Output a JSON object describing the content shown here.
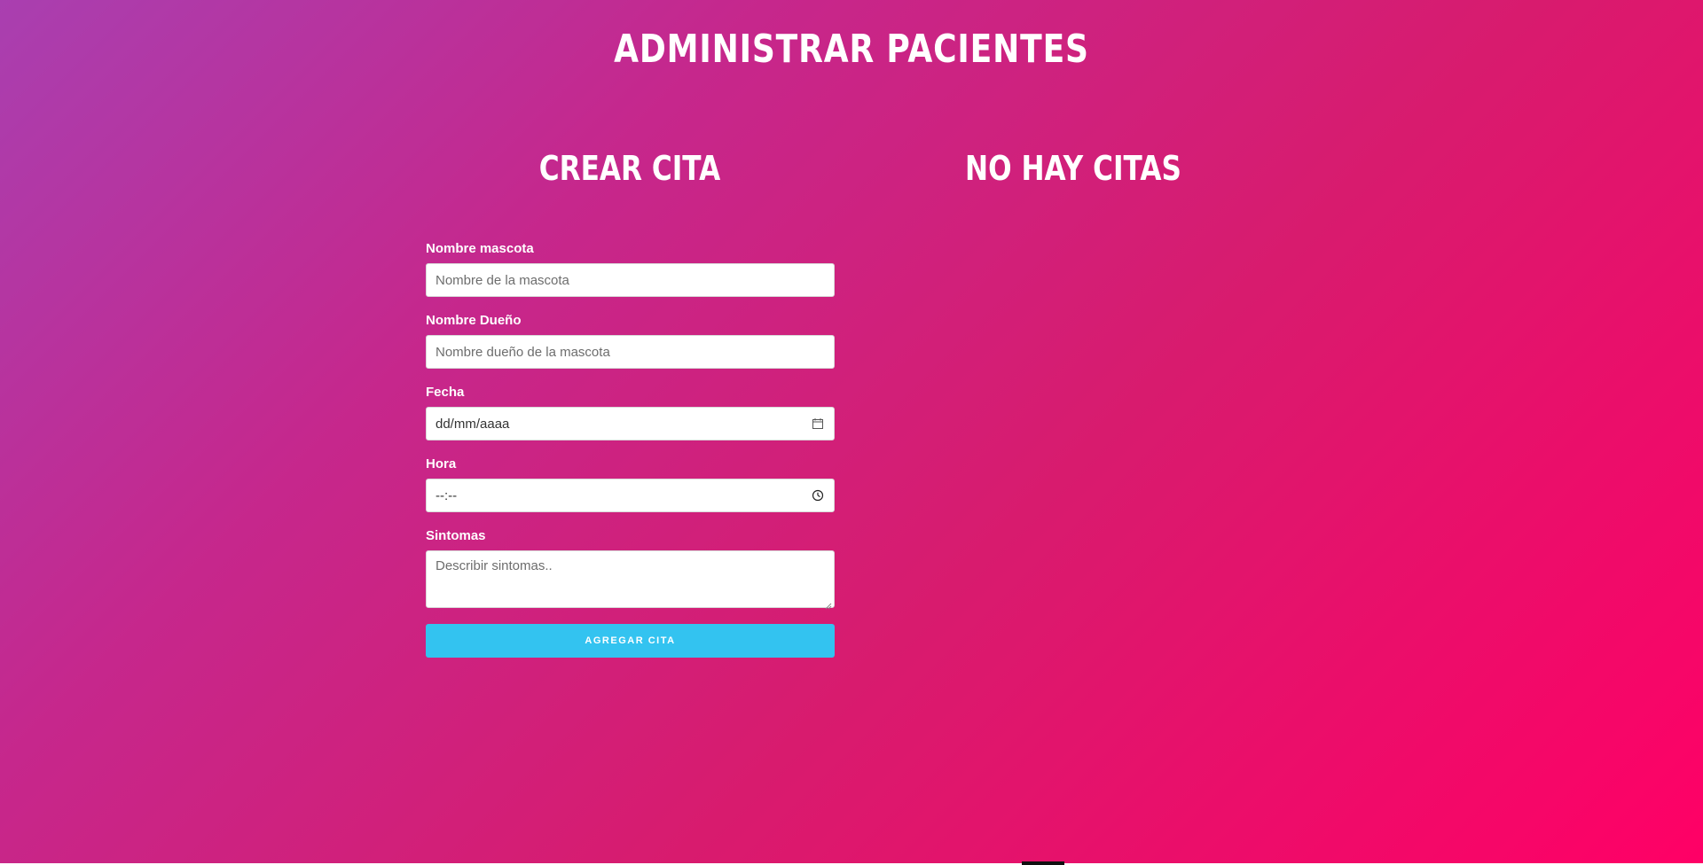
{
  "header": {
    "title": "ADMINISTRAR PACIENTES"
  },
  "left_column": {
    "title": "CREAR CITA"
  },
  "right_column": {
    "title": "NO HAY CITAS"
  },
  "form": {
    "pet_name": {
      "label": "Nombre mascota",
      "placeholder": "Nombre de la mascota"
    },
    "owner_name": {
      "label": "Nombre Dueño",
      "placeholder": "Nombre dueño de la mascota"
    },
    "date": {
      "label": "Fecha",
      "value": "dd/mm/aaaa",
      "icon": "calendar-icon"
    },
    "time": {
      "label": "Hora",
      "value": "--:--",
      "icon": "clock-icon"
    },
    "symptoms": {
      "label": "Sintomas",
      "placeholder": "Describir sintomas.."
    },
    "submit_label": "AGREGAR CITA"
  },
  "colors": {
    "gradient_start": "#a93fb0",
    "gradient_end": "#ff0066",
    "button": "#33c3f0",
    "text": "#ffffff"
  }
}
